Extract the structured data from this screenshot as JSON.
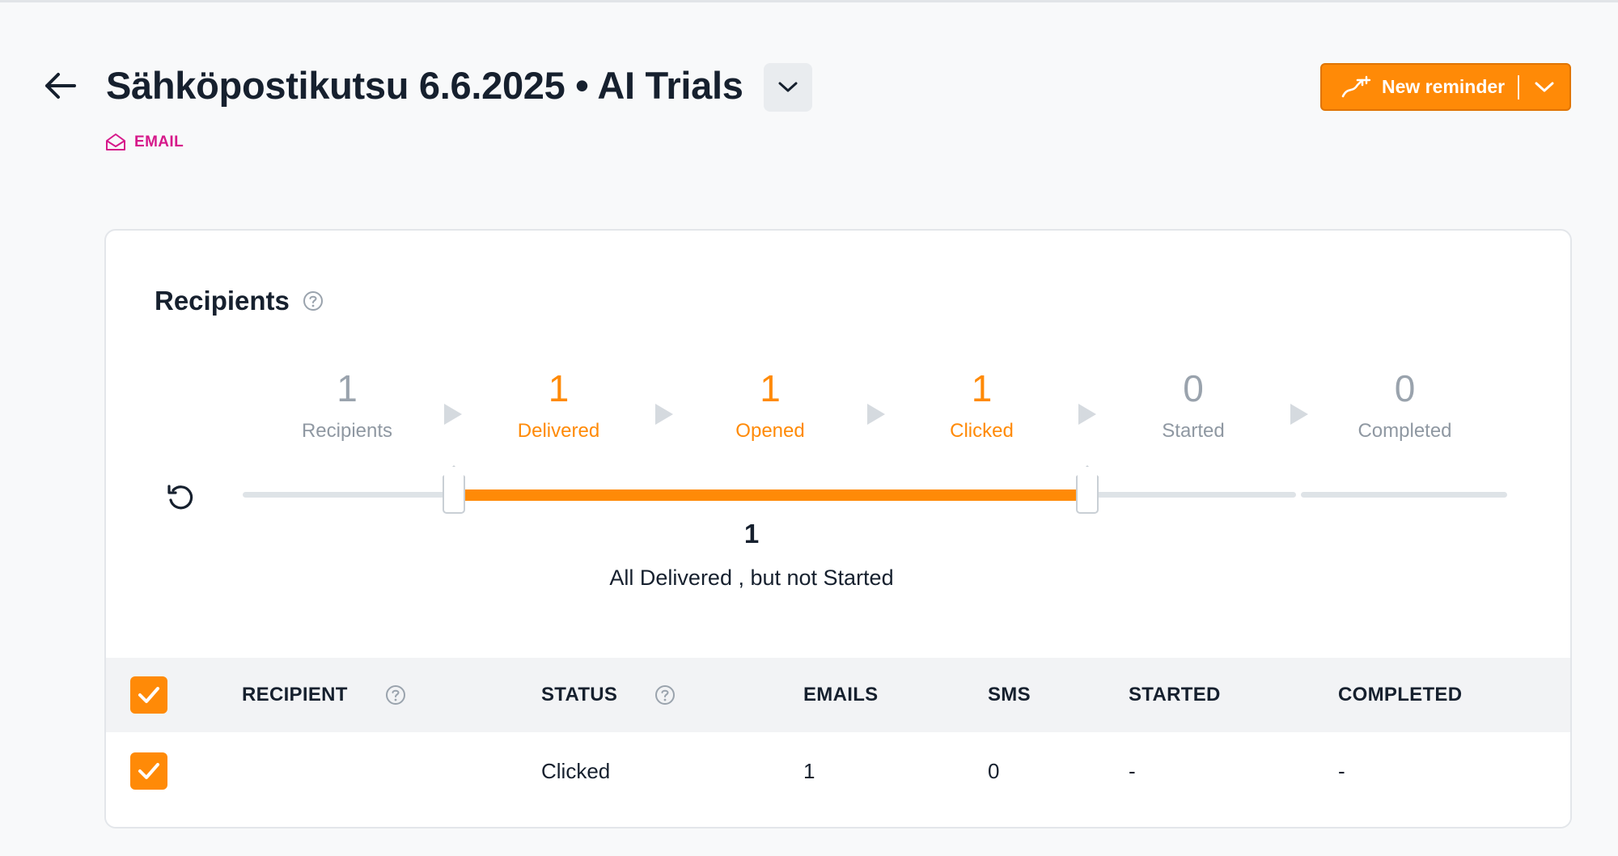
{
  "header": {
    "title": "Sähköpostikutsu 6.6.2025 • AI Trials",
    "channel": "EMAIL",
    "new_reminder_label": "New reminder"
  },
  "recipients_card": {
    "title": "Recipients",
    "funnel": [
      {
        "count": "1",
        "label": "Recipients",
        "active": false
      },
      {
        "count": "1",
        "label": "Delivered",
        "active": true
      },
      {
        "count": "1",
        "label": "Opened",
        "active": true
      },
      {
        "count": "1",
        "label": "Clicked",
        "active": true
      },
      {
        "count": "0",
        "label": "Started",
        "active": false
      },
      {
        "count": "0",
        "label": "Completed",
        "active": false
      }
    ],
    "range_start_step": 1,
    "range_end_step": 4,
    "selection_count": "1",
    "selection_description": "All Delivered , but not Started"
  },
  "table": {
    "columns": [
      "RECIPIENT",
      "STATUS",
      "EMAILS",
      "SMS",
      "STARTED",
      "COMPLETED"
    ],
    "rows": [
      {
        "recipient": "",
        "status": "Clicked",
        "emails": "1",
        "sms": "0",
        "started": "-",
        "completed": "-"
      }
    ]
  },
  "colors": {
    "accent": "#ff8a07",
    "email_badge": "#d6198a",
    "text": "#16202e",
    "muted": "#9aa3ad"
  },
  "icons": [
    "back-arrow-icon",
    "chevron-down-icon",
    "envelope-open-icon",
    "reminder-sparkle-icon",
    "help-circle-icon",
    "reset-icon",
    "check-icon"
  ]
}
